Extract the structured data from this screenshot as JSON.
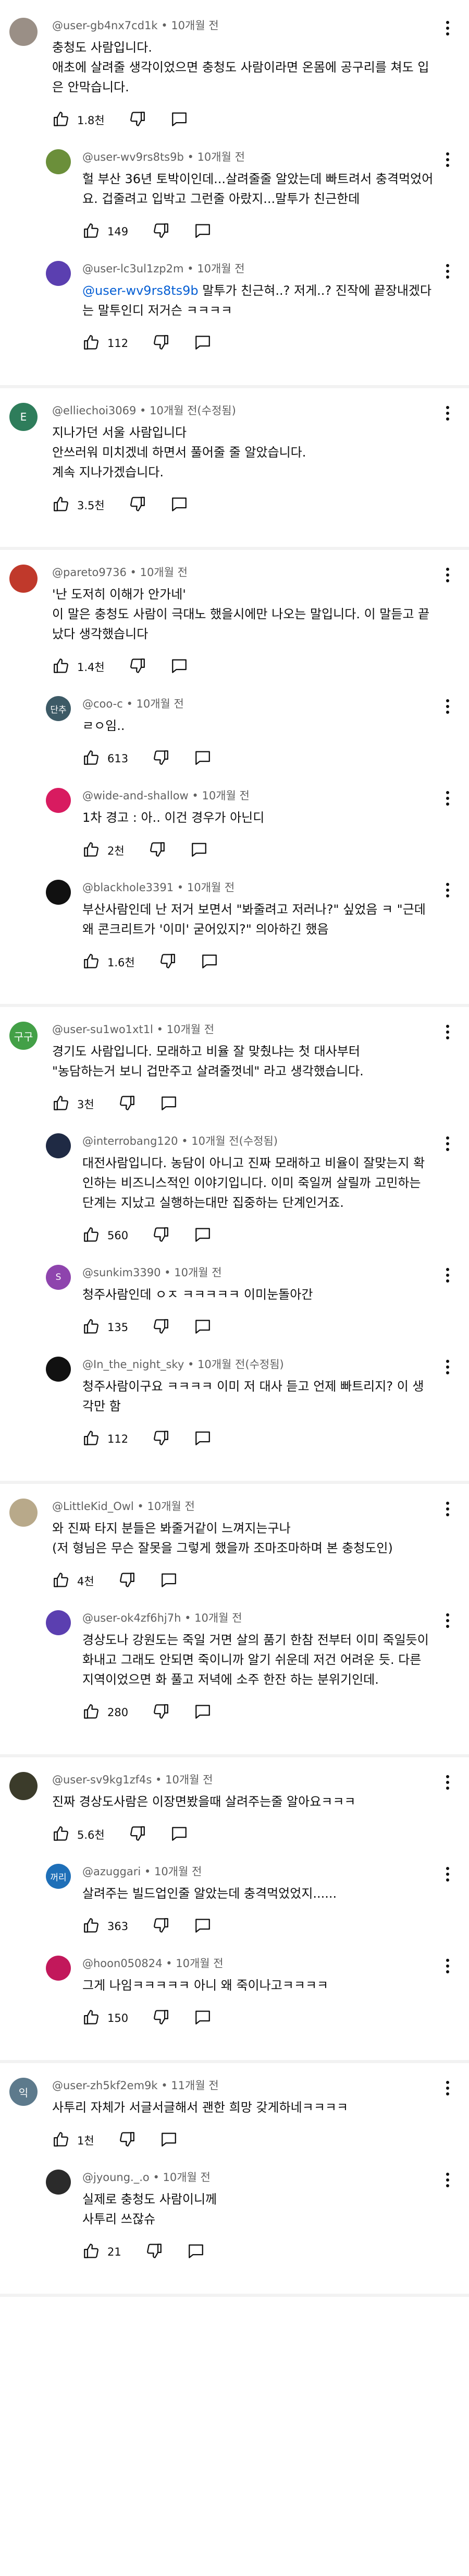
{
  "colors": {
    "meta_text": "#606060",
    "mention": "#065fd4",
    "divider": "#f2f2f2"
  },
  "threads": [
    {
      "comment": {
        "author": "@user-gb4nx7cd1k",
        "time": "10개월 전",
        "text": "충청도 사람입니다.\n애초에 살려줄 생각이었으면 충청도 사람이라면 온몸에 공구리를 쳐도 입은 안막습니다.",
        "likes": "1.8천",
        "avatar_color": "#9a8f86",
        "avatar_glyph": ""
      },
      "replies": [
        {
          "author": "@user-wv9rs8ts9b",
          "time": "10개월 전",
          "text": "헐 부산 36년 토박이인데...살려줄줄 알았는데 빠트려서 충격먹었어요. 겁줄려고 입박고 그런줄 아랐지...말투가 친근한데",
          "likes": "149",
          "avatar_color": "#6b8f3a",
          "avatar_glyph": ""
        },
        {
          "author": "@user-lc3ul1zp2m",
          "time": "10개월 전",
          "mention": "@user-wv9rs8ts9b",
          "text": "말투가 친근혀..? 저게..? 진작에 끝장내겠다는 말투인디 저거슨 ㅋㅋㅋㅋ",
          "likes": "112",
          "avatar_color": "#5b3fb0",
          "avatar_glyph": ""
        }
      ]
    },
    {
      "comment": {
        "author": "@elliechoi3069",
        "time": "10개월 전(수정됨)",
        "text": "지나가던 서울 사람입니다\n안쓰러워 미치겠네 하면서 풀어줄 줄 알았습니다.\n계속 지나가겠습니다.",
        "likes": "3.5천",
        "avatar_color": "#2e7d5b",
        "avatar_glyph": "E"
      },
      "replies": []
    },
    {
      "comment": {
        "author": "@pareto9736",
        "time": "10개월 전",
        "text": "'난 도저히 이해가 안가네'\n이 말은 충청도 사람이 극대노 했을시에만 나오는 말입니다. 이 말듣고 끝났다 생각했습니다",
        "likes": "1.4천",
        "avatar_color": "#c0392b",
        "avatar_glyph": ""
      },
      "replies": [
        {
          "author": "@coo-c",
          "time": "10개월 전",
          "text": "ㄹㅇ임..",
          "likes": "613",
          "avatar_color": "#3d5a66",
          "avatar_glyph": "단추"
        },
        {
          "author": "@wide-and-shallow",
          "time": "10개월 전",
          "text": "1차 경고 : 아.. 이건 경우가 아닌디",
          "likes": "2천",
          "avatar_color": "#d81b60",
          "avatar_glyph": ""
        },
        {
          "author": "@blackhole3391",
          "time": "10개월 전",
          "text": "부산사람인데 난 저거 보면서 \"봐줄려고 저러나?\" 싶었음 ㅋ \"근데 왜 콘크리트가 '이미' 굳어있지?\" 의아하긴 했음",
          "likes": "1.6천",
          "avatar_color": "#111111",
          "avatar_glyph": ""
        }
      ]
    },
    {
      "comment": {
        "author": "@user-su1wo1xt1l",
        "time": "10개월 전",
        "text": "경기도 사람입니다. 모래하고 비율 잘 맞췄냐는 첫 대사부터\n\"농담하는거 보니 겁만주고 살려줄껏네\" 라고 생각했습니다.",
        "likes": "3천",
        "avatar_color": "#43a047",
        "avatar_glyph": "구구"
      },
      "replies": [
        {
          "author": "@interrobang120",
          "time": "10개월 전(수정됨)",
          "text": "대전사람입니다. 농담이 아니고 진짜 모래하고 비율이 잘맞는지 확인하는 비즈니스적인 이야기입니다. 이미 죽일꺼 살릴까 고민하는 단계는 지났고 실행하는대만 집중하는 단계인거죠.",
          "likes": "560",
          "avatar_color": "#1f2a44",
          "avatar_glyph": ""
        },
        {
          "author": "@sunkim3390",
          "time": "10개월 전",
          "text": "청주사람인데 ㅇㅈ ㅋㅋㅋㅋㅋ 이미눈돌아간",
          "likes": "135",
          "avatar_color": "#8e44ad",
          "avatar_glyph": "S"
        },
        {
          "author": "@In_the_night_sky",
          "time": "10개월 전(수정됨)",
          "text": "청주사람이구요 ㅋㅋㅋㅋ 이미 저 대사 듣고 언제 빠트리지? 이 생각만 함",
          "likes": "112",
          "avatar_color": "#111111",
          "avatar_glyph": ""
        }
      ]
    },
    {
      "comment": {
        "author": "@LittleKid_Owl",
        "time": "10개월 전",
        "text": "와 진짜 타지 분들은 봐줄거같이 느껴지는구나\n(저 형님은 무슨 잘못을 그렇게 했을까 조마조마하며 본 충청도인)",
        "likes": "4천",
        "avatar_color": "#b8a98a",
        "avatar_glyph": ""
      },
      "replies": [
        {
          "author": "@user-ok4zf6hj7h",
          "time": "10개월 전",
          "text": "경상도나 강원도는 죽일 거면 살의 품기 한참 전부터 이미 죽일듯이 화내고 그래도 안되면 죽이니까 알기 쉬운데 저건 어려운 듯. 다른 지역이었으면 화 풀고 저녁에 소주 한잔 하는 분위기인데.",
          "likes": "280",
          "avatar_color": "#5b3fb0",
          "avatar_glyph": ""
        }
      ]
    },
    {
      "comment": {
        "author": "@user-sv9kg1zf4s",
        "time": "10개월 전",
        "text": "진짜 경상도사람은 이장면봤을때 살려주는줄 알아요ㅋㅋㅋ",
        "likes": "5.6천",
        "avatar_color": "#3b3b2a",
        "avatar_glyph": ""
      },
      "replies": [
        {
          "author": "@azuggari",
          "time": "10개월 전",
          "text": "살려주는 빌드업인줄 알았는데 충격먹었었지......",
          "likes": "363",
          "avatar_color": "#1e6fb8",
          "avatar_glyph": "꺼리"
        },
        {
          "author": "@hoon050824",
          "time": "10개월 전",
          "text": "그게 나임ㅋㅋㅋㅋㅋ 아니 왜 죽이나고ㅋㅋㅋㅋ",
          "likes": "150",
          "avatar_color": "#c2185b",
          "avatar_glyph": ""
        }
      ]
    },
    {
      "comment": {
        "author": "@user-zh5kf2em9k",
        "time": "11개월 전",
        "text": "사투리 자체가 서글서글해서 괜한 희망 갖게하네ㅋㅋㅋㅋ",
        "likes": "1천",
        "avatar_color": "#5d7a8c",
        "avatar_glyph": "익"
      },
      "replies": [
        {
          "author": "@jyoung._.o",
          "time": "10개월 전",
          "text": "실제로 충청도 사람이니께\n사투리 쓰잖슈",
          "likes": "21",
          "avatar_color": "#2b2b2b",
          "avatar_glyph": ""
        }
      ]
    }
  ]
}
